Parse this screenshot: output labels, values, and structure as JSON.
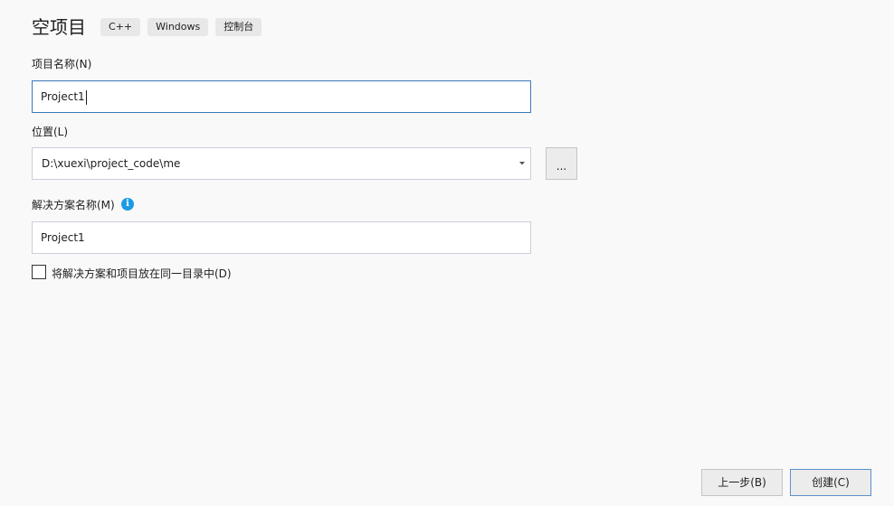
{
  "header": {
    "title": "空项目",
    "tags": [
      "C++",
      "Windows",
      "控制台"
    ]
  },
  "project_name": {
    "label": "项目名称(N)",
    "value": "Project1"
  },
  "location": {
    "label": "位置(L)",
    "value": "D:\\xuexi\\project_code\\me",
    "browse_label": "..."
  },
  "solution_name": {
    "label": "解决方案名称(M)",
    "value": "Project1",
    "info_glyph": "i"
  },
  "same_dir": {
    "label": "将解决方案和项目放在同一目录中(D)",
    "checked": false
  },
  "footer": {
    "back_label": "上一步(B)",
    "create_label": "创建(C)"
  },
  "colors": {
    "background": "#f9f9f9",
    "focus_border": "#3a7ab8",
    "info_icon": "#1b9ae6",
    "primary_button_border": "#5b8fc9"
  },
  "icons": {
    "dropdown": "chevron-down-icon",
    "info": "info-icon"
  }
}
